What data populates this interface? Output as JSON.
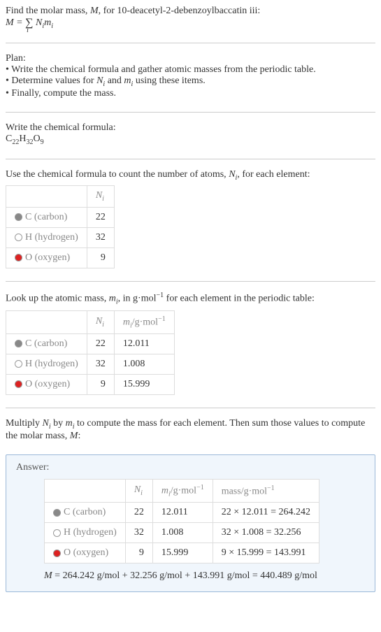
{
  "header": {
    "line1_pre": "Find the molar mass, ",
    "line1_M": "M",
    "line1_post": ", for 10-deacetyl-2-debenzoylbaccatin iii:",
    "eq_left": "M = ",
    "eq_sigma": "∑",
    "eq_sub": "i",
    "eq_right": " N",
    "eq_right_sub": "i",
    "eq_m": "m",
    "eq_m_sub": "i"
  },
  "plan": {
    "title": "Plan:",
    "item1": "• Write the chemical formula and gather atomic masses from the periodic table.",
    "item2_pre": "• Determine values for ",
    "item2_N": "N",
    "item2_N_sub": "i",
    "item2_and": " and ",
    "item2_m": "m",
    "item2_m_sub": "i",
    "item2_post": " using these items.",
    "item3": "• Finally, compute the mass."
  },
  "chemical": {
    "title": "Write the chemical formula:",
    "c": "C",
    "c_n": "22",
    "h": "H",
    "h_n": "32",
    "o": "O",
    "o_n": "9"
  },
  "count": {
    "intro_pre": "Use the chemical formula to count the number of atoms, ",
    "intro_N": "N",
    "intro_N_sub": "i",
    "intro_post": ", for each element:",
    "header_N": "N",
    "header_N_sub": "i",
    "rows": [
      {
        "label": "C (carbon)",
        "n": "22"
      },
      {
        "label": "H (hydrogen)",
        "n": "32"
      },
      {
        "label": "O (oxygen)",
        "n": "9"
      }
    ]
  },
  "lookup": {
    "intro_pre": "Look up the atomic mass, ",
    "intro_m": "m",
    "intro_m_sub": "i",
    "intro_mid": ", in g·mol",
    "intro_exp": "−1",
    "intro_post": " for each element in the periodic table:",
    "h_N": "N",
    "h_N_sub": "i",
    "h_m": "m",
    "h_m_sub": "i",
    "h_unit": "/g·mol",
    "h_unit_exp": "−1",
    "rows": [
      {
        "label": "C (carbon)",
        "n": "22",
        "m": "12.011"
      },
      {
        "label": "H (hydrogen)",
        "n": "32",
        "m": "1.008"
      },
      {
        "label": "O (oxygen)",
        "n": "9",
        "m": "15.999"
      }
    ]
  },
  "multiply": {
    "pre": "Multiply ",
    "N": "N",
    "N_sub": "i",
    "by": " by ",
    "m": "m",
    "m_sub": "i",
    "mid": " to compute the mass for each element. Then sum those values to compute the molar mass, ",
    "M": "M",
    "post": ":"
  },
  "answer": {
    "label": "Answer:",
    "h_N": "N",
    "h_N_sub": "i",
    "h_m": "m",
    "h_m_sub": "i",
    "h_m_unit": "/g·mol",
    "h_m_exp": "−1",
    "h_mass": "mass/g·mol",
    "h_mass_exp": "−1",
    "rows": [
      {
        "label": "C (carbon)",
        "n": "22",
        "m": "12.011",
        "mass": "22 × 12.011 = 264.242"
      },
      {
        "label": "H (hydrogen)",
        "n": "32",
        "m": "1.008",
        "mass": "32 × 1.008 = 32.256"
      },
      {
        "label": "O (oxygen)",
        "n": "9",
        "m": "15.999",
        "mass": "9 × 15.999 = 143.991"
      }
    ],
    "final_M": "M",
    "final_eq": " = 264.242 g/mol + 32.256 g/mol + 143.991 g/mol = 440.489 g/mol"
  }
}
